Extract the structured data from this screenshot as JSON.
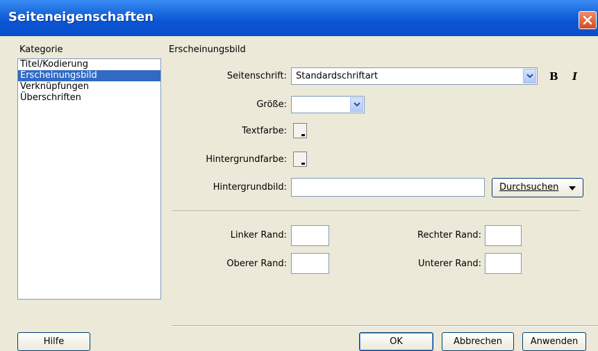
{
  "window": {
    "title": "Seiteneigenschaften",
    "accent": "#0a55d6",
    "close_icon": "close-icon"
  },
  "category": {
    "label": "Kategorie",
    "items": [
      "Titel/Kodierung",
      "Erscheinungsbild",
      "Verknüpfungen",
      "Überschriften"
    ],
    "selected": "Erscheinungsbild",
    "selected_color": "#316ac5"
  },
  "appearance": {
    "title": "Erscheinungsbild",
    "font_label": "Seitenschrift:",
    "font_value": "Standardschriftart",
    "bold_label": "B",
    "italic_label": "I",
    "size_label": "Größe:",
    "size_value": "",
    "text_color_label": "Textfarbe:",
    "bg_color_label": "Hintergrundfarbe:",
    "bg_image_label": "Hintergrundbild:",
    "bg_image_value": "",
    "browse_label": "Durchsuchen",
    "left_margin_label": "Linker Rand:",
    "right_margin_label": "Rechter Rand:",
    "top_margin_label": "Oberer Rand:",
    "bottom_margin_label": "Unterer Rand:"
  },
  "buttons": {
    "help": "Hilfe",
    "ok": "OK",
    "cancel": "Abbrechen",
    "apply": "Anwenden"
  }
}
